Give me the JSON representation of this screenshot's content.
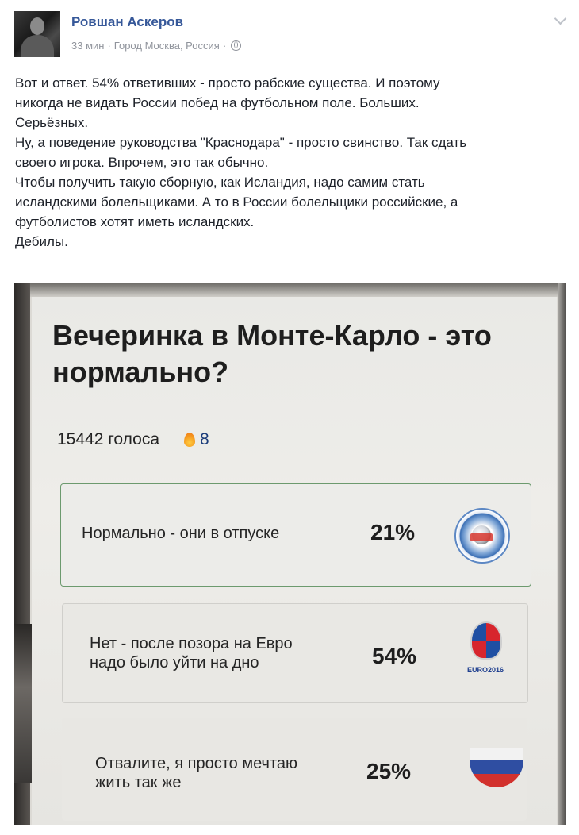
{
  "post": {
    "author": "Ровшан Аскеров",
    "time": "33 мин",
    "location": "Город Москва, Россия",
    "meta_separator": "·",
    "privacy_icon": "globe-icon",
    "menu_icon": "chevron-down-icon",
    "text_lines": [
      "Вот и ответ. 54% ответивших - просто рабские существа. И поэтому",
      "никогда не видать России побед на футбольном поле. Больших.",
      "Серьёзных.",
      "Ну, а поведение руководства \"Краснодара\" - просто свинство. Так сдать",
      "своего игрока. Впрочем, это так обычно.",
      "Чтобы получить такую сборную, как Исландия, надо самим стать",
      "исландскими болельщиками. А то в России болельщики российские, а",
      "футболистов хотят иметь исландских.",
      "Дебилы."
    ]
  },
  "poll": {
    "title_line1": "Вечеринка в Монте-Карло - это",
    "title_line2": "нормально?",
    "votes": "15442 голоса",
    "hot_count": "8",
    "options": [
      {
        "label_line1": "Нормально - они в отпуске",
        "label_line2": "",
        "percent": "21%",
        "value": 21,
        "icon": "rfpl-logo-icon"
      },
      {
        "label_line1": "Нет - после позора на Евро",
        "label_line2": "надо было уйти на дно",
        "percent": "54%",
        "value": 54,
        "icon": "euro-2016-logo-icon",
        "logo_text": "EURO2016"
      },
      {
        "label_line1": "Отвалите, я просто мечтаю",
        "label_line2": "жить так же",
        "percent": "25%",
        "value": 25,
        "icon": "russia-flag-icon"
      }
    ]
  }
}
